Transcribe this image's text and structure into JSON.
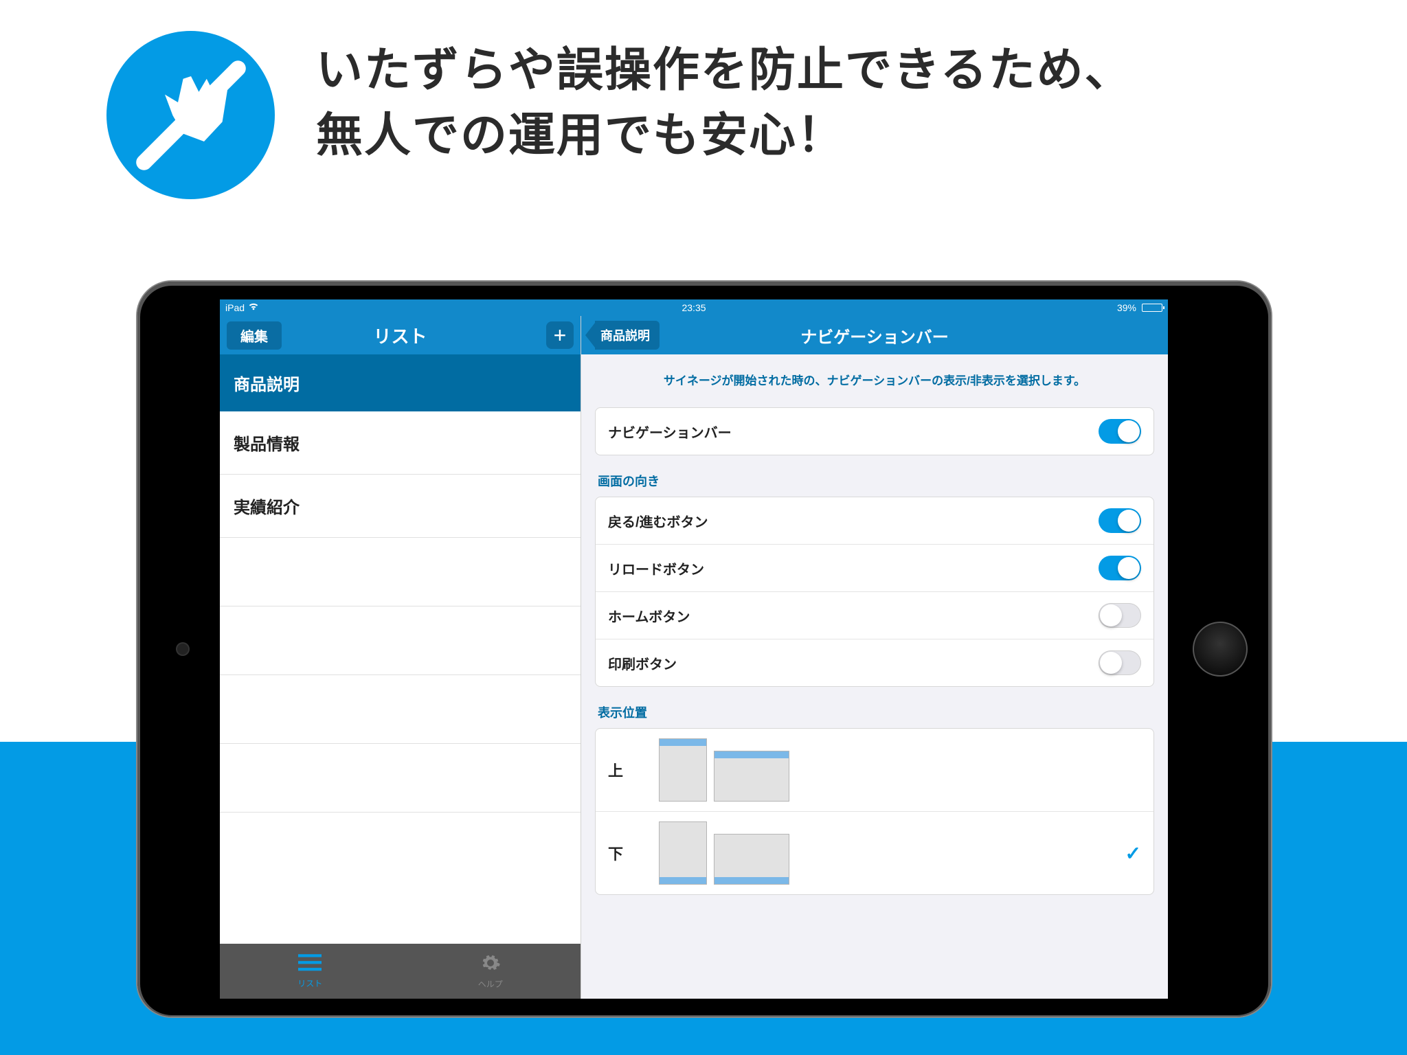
{
  "headline": {
    "line1": "いたずらや誤操作を防止できるため、",
    "line2": "無人での運用でも安心！"
  },
  "statusbar": {
    "device": "iPad",
    "time": "23:35",
    "battery_pct": "39%"
  },
  "sidebar": {
    "edit": "編集",
    "title": "リスト",
    "selected": "商品説明",
    "items": [
      "製品情報",
      "実績紹介"
    ]
  },
  "tabbar": {
    "list": "リスト",
    "help": "ヘルプ"
  },
  "detail": {
    "back": "商品説明",
    "title": "ナビゲーションバー",
    "instruction": "サイネージが開始された時の、ナビゲーションバーの表示/非表示を選択します。",
    "navbar_toggle_label": "ナビゲーションバー",
    "section_orientation": "画面の向き",
    "toggles": {
      "back_forward": "戻る/進むボタン",
      "reload": "リロードボタン",
      "home": "ホームボタン",
      "print": "印刷ボタン"
    },
    "toggle_state": {
      "navbar": true,
      "back_forward": true,
      "reload": true,
      "home": false,
      "print": false
    },
    "section_position": "表示位置",
    "position": {
      "top": "上",
      "bottom": "下",
      "selected": "bottom"
    }
  },
  "icons": {
    "hero": "no-touch-icon",
    "plus": "+",
    "hamburger": "≡",
    "gear": "⚙",
    "wifi": "wifi-icon",
    "check": "✓"
  }
}
